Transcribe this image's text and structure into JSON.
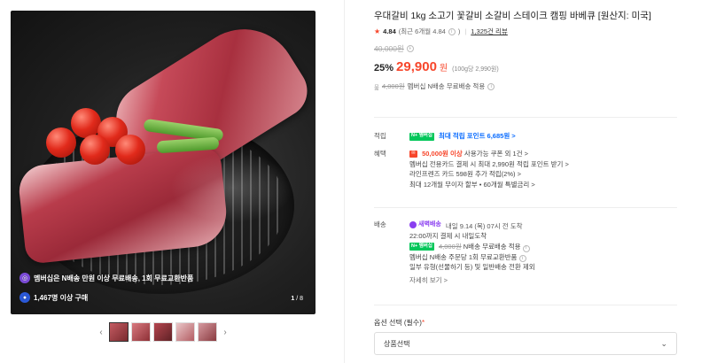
{
  "gallery": {
    "badges": [
      {
        "icon": "membership-icon",
        "text": "멤버십은 N배송 만원 이상 무료배송, 1회 무료교환반품",
        "color": "#7d4cdb"
      },
      {
        "icon": "person-icon",
        "text": "1,467명 이상 구매",
        "color": "#2b59d8"
      }
    ],
    "counter_current": "1",
    "counter_total": "/ 8",
    "thumbnails_count": 5
  },
  "product": {
    "title": "우대갈비 1kg 소고기 꽃갈비 소갈비 스테이크 캠핑 바베큐 [원산지: 미국]",
    "rating": "4.84",
    "rating_recent": "(최근 6개월 4.84",
    "reviews": "1,325건 리뷰",
    "original_price": "40,000원",
    "discount": "25%",
    "price": "29,900",
    "won": "원",
    "unit_price": "(100g당 2,990원)"
  },
  "shipping_summary": {
    "prefix": "뭂",
    "old_fee": "4,000원",
    "text": "멤버십 N배송 무료배송 적용"
  },
  "points": {
    "label": "적립",
    "badge": "N+ 멤버십",
    "text": "최대 적립 포인트 6,685원 >"
  },
  "benefits": {
    "label": "혜택",
    "coupon_text": "50,000원 이상",
    "coupon_suffix": "사용가능 쿠폰 외 1건 >",
    "lines": [
      "멤버십 전용카드 결제 시 최대 2,990원 적립 포인트 받기 >",
      "라인프렌즈 카드 598원 추가 적립(2%) >",
      "최대 12개월 무이자 할부 • 60개월 특별금리 >"
    ]
  },
  "delivery": {
    "label": "배송",
    "badge": "새벽배송",
    "date": "내일 9.14 (목) 07시 전 도착",
    "cutoff": "22:00까지 결제 시 내일도착",
    "npay_badge": "N+ 멤버십",
    "old_fee": "4,000원",
    "fee_text": "N배송 무료배송 적용",
    "exchange": "멤버십 N배송 주문당 1회 무료교환반품",
    "exclusion": "일부 유형(선물하기 등) 및 일반배송 전환 제외",
    "more": "자세히 보기 >"
  },
  "options": {
    "label": "옵션 선택 (필수)",
    "required_mark": "*",
    "select_value": "상품선택"
  },
  "colors": {
    "accent_red": "#f7462b",
    "naver_green": "#03c75a",
    "link_blue": "#0a6cff",
    "purple": "#8a3ff0"
  }
}
